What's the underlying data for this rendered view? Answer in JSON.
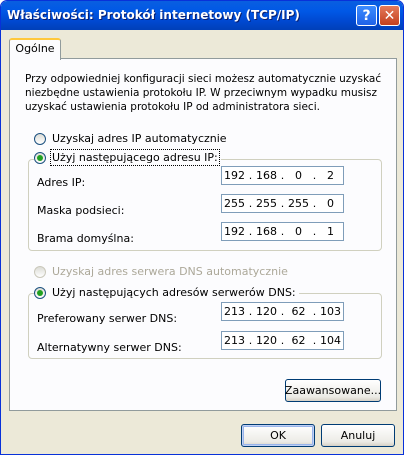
{
  "window": {
    "title": "Właściwości: Protokół internetowy (TCP/IP)",
    "help_glyph": "?",
    "close_glyph": "✕"
  },
  "tabs": [
    {
      "label": "Ogólne",
      "selected": true
    }
  ],
  "intro_text": "Przy odpowiedniej konfiguracji sieci możesz automatycznie uzyskać niezbędne ustawienia protokołu IP. W przeciwnym wypadku musisz uzyskać ustawienia protokołu IP od administratora sieci.",
  "ip_mode": {
    "auto_label": "Uzyskaj adres IP automatycznie",
    "manual_label": "Użyj następującego adresu IP:",
    "selected": "manual"
  },
  "ip_fields": [
    {
      "label": "Adres IP:",
      "octets": [
        "192",
        "168",
        "0",
        "2"
      ]
    },
    {
      "label": "Maska podsieci:",
      "octets": [
        "255",
        "255",
        "255",
        "0"
      ]
    },
    {
      "label": "Brama domyślna:",
      "octets": [
        "192",
        "168",
        "0",
        "1"
      ]
    }
  ],
  "dns_mode": {
    "auto_label": "Uzyskaj adres serwera DNS automatycznie",
    "manual_label": "Użyj następujących adresów serwerów DNS:",
    "selected": "manual"
  },
  "dns_fields": [
    {
      "label": "Preferowany serwer DNS:",
      "octets": [
        "213",
        "120",
        "62",
        "103"
      ]
    },
    {
      "label": "Alternatywny serwer DNS:",
      "octets": [
        "213",
        "120",
        "62",
        "104"
      ]
    }
  ],
  "ip_separator": ".",
  "buttons": {
    "advanced": "Zaawansowane...",
    "ok": "OK",
    "cancel": "Anuluj"
  },
  "colors": {
    "titlebar": "#0058e6",
    "window_bg": "#ece9d8",
    "radio_on": "#21a121",
    "close_button": "#c4401e"
  }
}
